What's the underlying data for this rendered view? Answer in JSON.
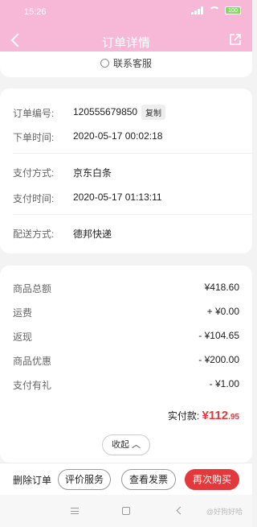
{
  "status_bar": {
    "time": "15:26",
    "battery": "100"
  },
  "nav": {
    "title": "订单详情"
  },
  "contact": {
    "label": "联系客服"
  },
  "order_info": {
    "order_no_label": "订单编号:",
    "order_no": "120555679850",
    "copy_label": "复制",
    "order_time_label": "下单时间:",
    "order_time": "2020-05-17 00:02:18",
    "pay_method_label": "支付方式:",
    "pay_method": "京东白条",
    "pay_time_label": "支付时间:",
    "pay_time": "2020-05-17 01:13:11",
    "delivery_label": "配送方式:",
    "delivery": "德邦快递"
  },
  "price": {
    "rows": [
      {
        "label": "商品总额",
        "value": "¥418.60"
      },
      {
        "label": "运费",
        "value": "+ ¥0.00"
      },
      {
        "label": "返现",
        "value": "- ¥104.65"
      },
      {
        "label": "商品优惠",
        "value": "- ¥200.00"
      },
      {
        "label": "支付有礼",
        "value": "- ¥1.00"
      }
    ],
    "paid_label": "实付款:",
    "paid_symbol": "¥",
    "paid_int": "112",
    "paid_dec": ".95"
  },
  "collapse_label": "收起 ︿",
  "actions": {
    "delete": "删除订单",
    "review": "评价服务",
    "invoice": "查看发票",
    "rebuy": "再次购买"
  },
  "watermark": "@好狗好哈"
}
